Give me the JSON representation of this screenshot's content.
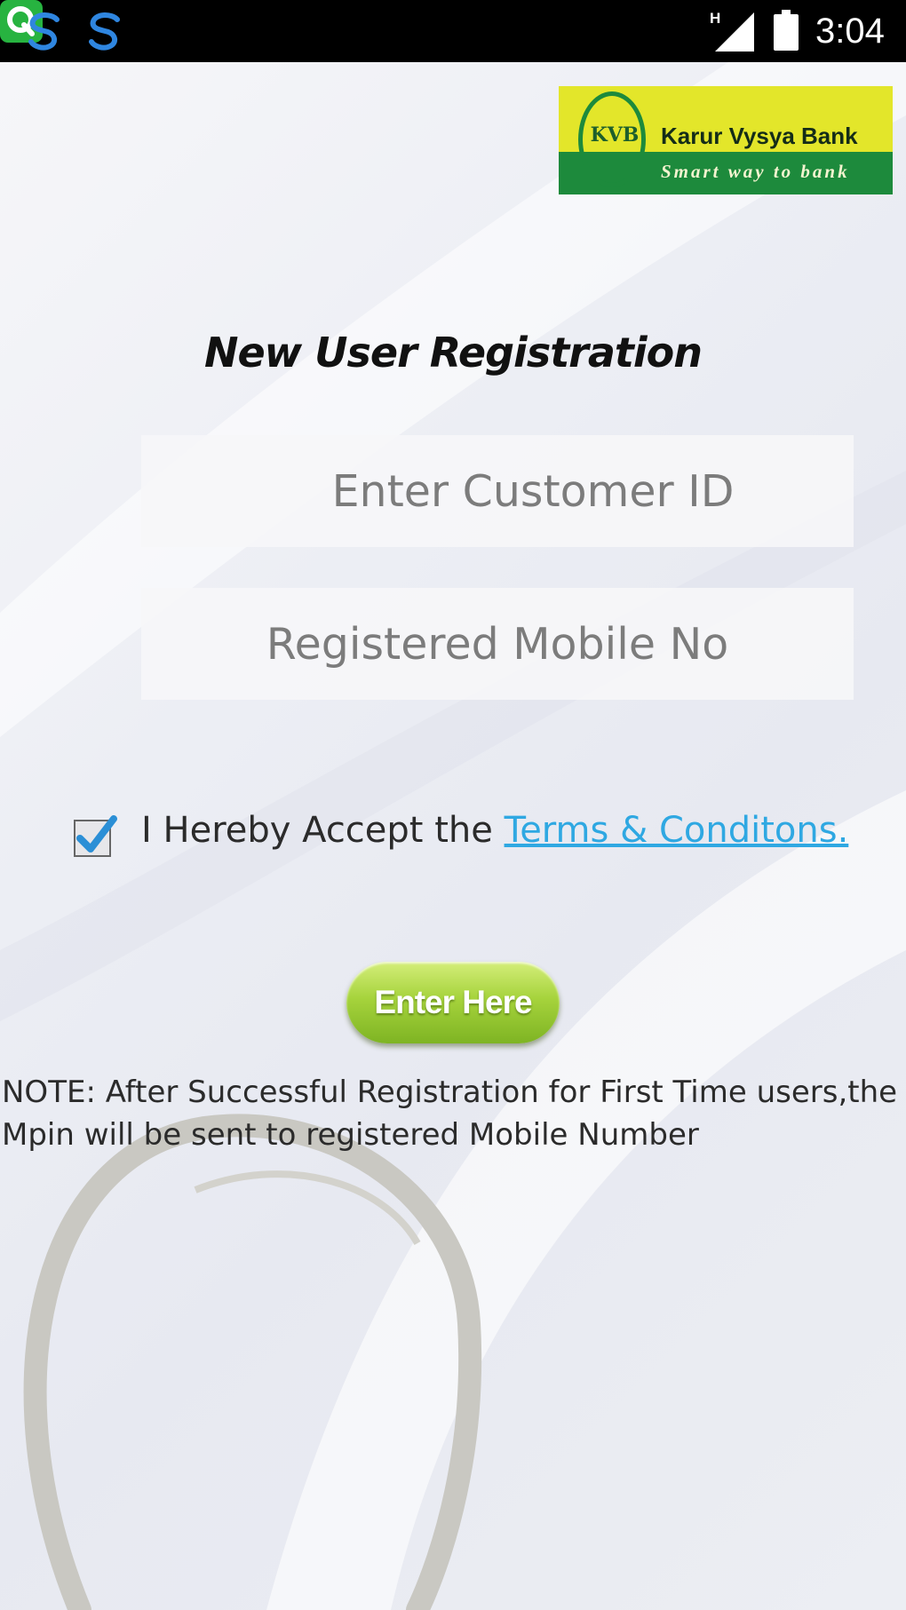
{
  "status_bar": {
    "time": "3:04",
    "network_label": "H",
    "notification_icons": [
      "s-app-icon",
      "s-app-icon",
      "q-app-icon"
    ],
    "q_icon_letter": "Q"
  },
  "logo": {
    "abbr": "KVB",
    "name": "Karur Vysya Bank",
    "tagline": "Smart way to bank",
    "colors": {
      "yellow": "#e3e62a",
      "green": "#1d8a3c"
    }
  },
  "page": {
    "title": "New User Registration"
  },
  "form": {
    "customer_id_placeholder": "Enter Customer ID",
    "mobile_placeholder": "Registered Mobile No",
    "terms_checked": true,
    "terms_prefix": "I Hereby Accept the ",
    "terms_link": "Terms & Conditons.",
    "submit_label": "Enter Here"
  },
  "note": "NOTE: After Successful Registration for First Time users,the Mpin will be sent to registered Mobile Number",
  "colors": {
    "link": "#2fa8e2",
    "checkbox_check": "#2b8fd6",
    "button_green": "#a6d33c"
  }
}
